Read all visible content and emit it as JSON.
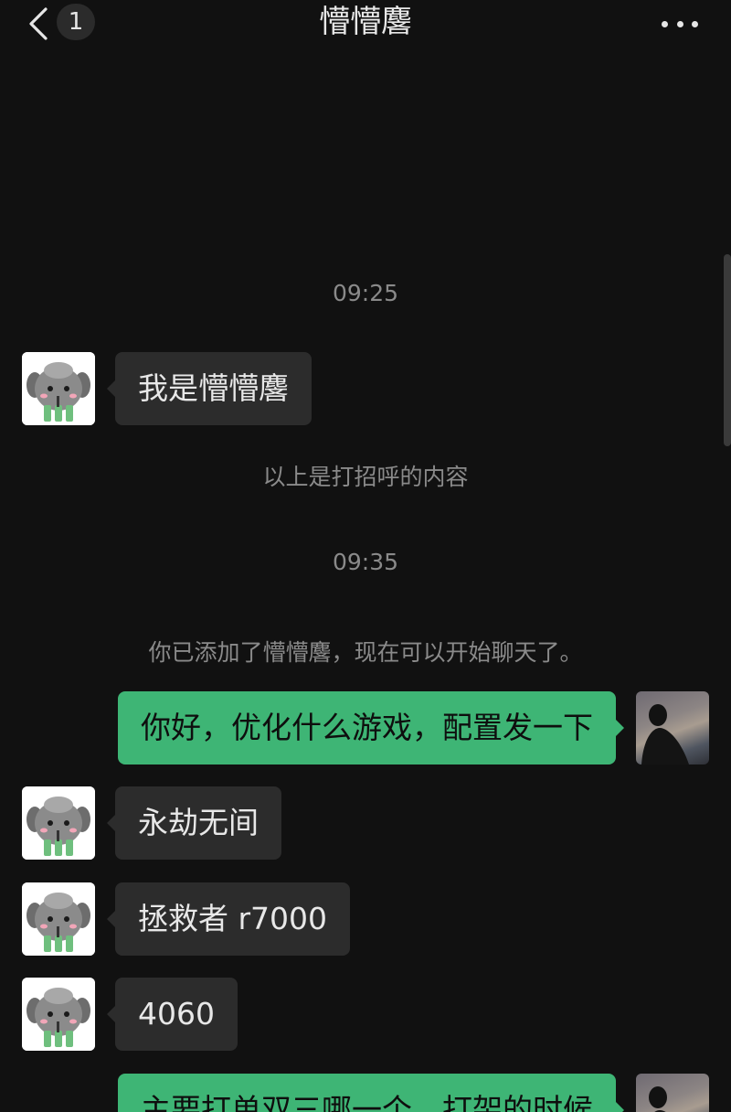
{
  "header": {
    "back_icon": "chevron-left-icon",
    "unread_count": "1",
    "title": "懵懵麐",
    "more_icon": "ellipsis-icon"
  },
  "messages": [
    {
      "type": "time",
      "text": "09:25"
    },
    {
      "type": "peer",
      "text": "我是懵懵麐"
    },
    {
      "type": "system",
      "text": "以上是打招呼的内容"
    },
    {
      "type": "time",
      "text": "09:35"
    },
    {
      "type": "system",
      "text": "你已添加了懵懵麐，现在可以开始聊天了。"
    },
    {
      "type": "me",
      "text": "你好，优化什么游戏，配置发一下"
    },
    {
      "type": "peer",
      "text": "永劫无间"
    },
    {
      "type": "peer",
      "text": "拯救者 r7000"
    },
    {
      "type": "peer",
      "text": "4060"
    },
    {
      "type": "me",
      "text": "主要打单双三哪一个，打架的时候"
    }
  ],
  "colors": {
    "background": "#111111",
    "my_bubble": "#3eb575",
    "peer_bubble": "#2c2c2c",
    "system_text": "#8a8a8a"
  }
}
